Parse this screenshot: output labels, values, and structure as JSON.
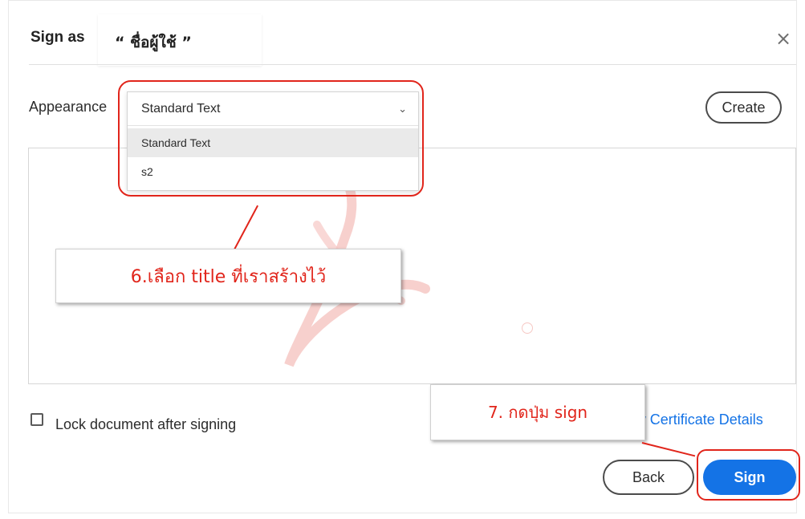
{
  "dialog": {
    "title": "Sign as",
    "signer_name": "“ ชื่อผู้ใช้ ”",
    "close_glyph": "×"
  },
  "appearance": {
    "label": "Appearance",
    "selected": "Standard Text",
    "options": [
      "Standard Text",
      "s2"
    ],
    "create_label": "Create"
  },
  "footer": {
    "lock_label": "Lock document after signing",
    "cert_link": "View Certificate Details",
    "back_label": "Back",
    "sign_label": "Sign"
  },
  "annotations": {
    "step6": "6.เลือก title ที่เราสร้างไว้",
    "step7": "7. กดปุ่ม sign"
  },
  "colors": {
    "accent": "#1473e6",
    "annotation": "#e1251b",
    "watermark": "#f6c8c4"
  },
  "icons": {
    "close": "close-icon",
    "chevron": "chevron-down-icon",
    "checkbox": "checkbox-icon",
    "watermark": "acrobat-logo-icon"
  }
}
